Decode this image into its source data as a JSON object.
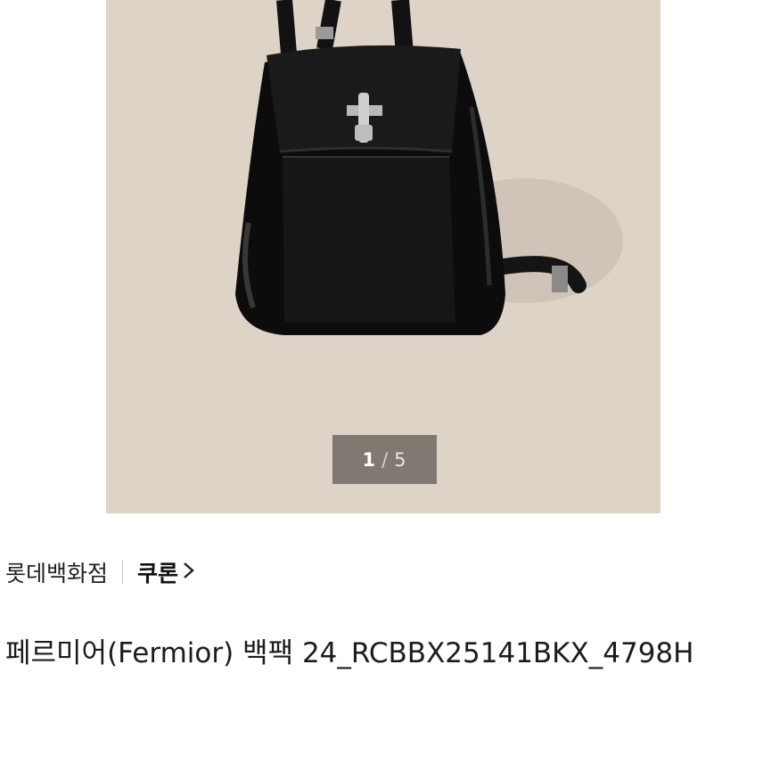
{
  "gallery": {
    "counter_current": "1",
    "counter_separator": "/",
    "counter_total": "5",
    "background_color": "#ddd3c7"
  },
  "seller": {
    "store": "롯데백화점",
    "brand": "쿠론",
    "chevron": "›"
  },
  "product": {
    "title": "페르미어(Fermior) 백팩 24_RCBBX25141BKX_4798H"
  },
  "price": {
    "partial": "₩"
  }
}
